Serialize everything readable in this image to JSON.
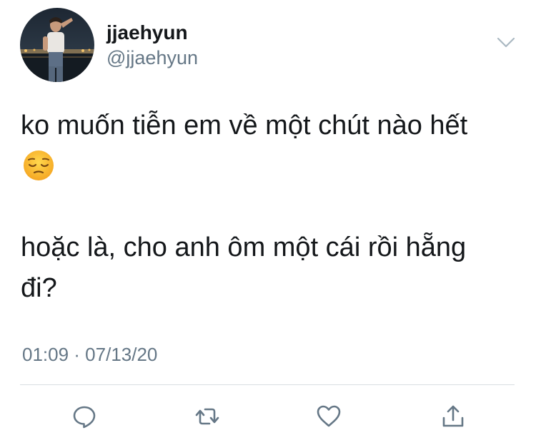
{
  "tweet": {
    "author": {
      "display_name": "jjaehyun",
      "handle": "@jjaehyun",
      "avatar_icon": "profile-photo"
    },
    "text_lines": [
      "ko muốn tiễn em về một chút nào hết",
      "hoặc là, cho anh ôm một cái rồi hẵng",
      "đi?"
    ],
    "emoji": "pensive-face-emoji",
    "timestamp": "01:09 · 07/13/20",
    "actions": {
      "reply_icon": "comment-icon",
      "retweet_icon": "retweet-icon",
      "like_icon": "heart-icon",
      "share_icon": "share-icon"
    }
  },
  "colors": {
    "text": "#14171a",
    "secondary": "#657786",
    "divider": "#d8dde2",
    "icon": "#657786",
    "accent": "#1da1f2"
  }
}
